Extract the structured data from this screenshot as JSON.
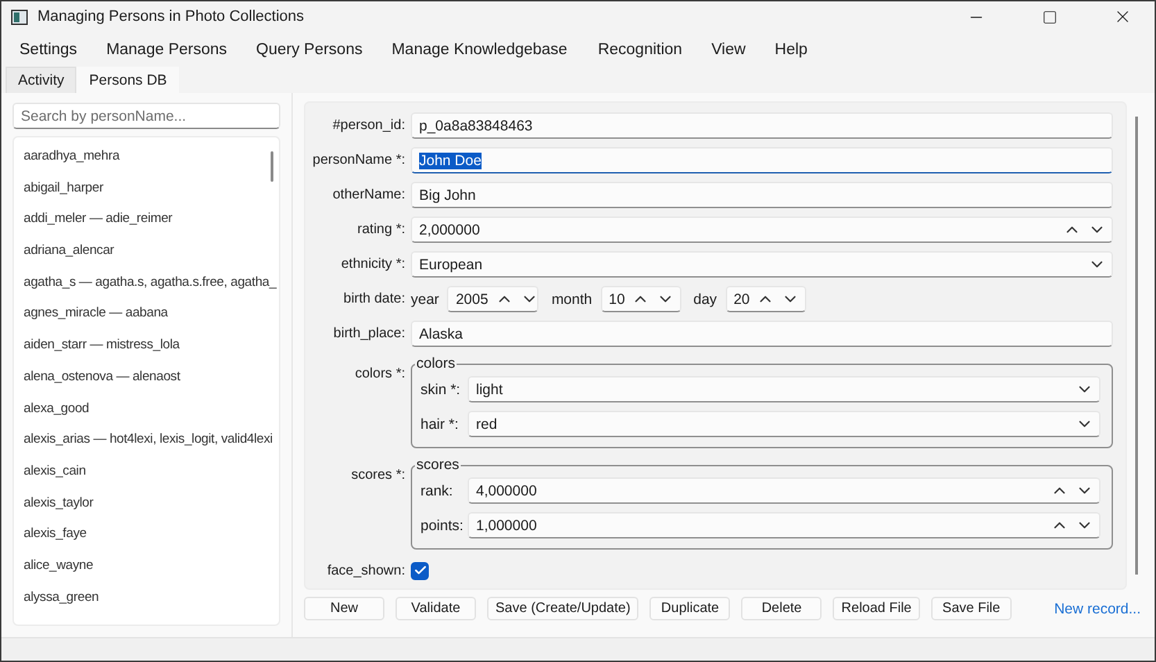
{
  "window": {
    "title": "Managing Persons in Photo Collections"
  },
  "menu": [
    "Settings",
    "Manage Persons",
    "Query Persons",
    "Manage Knowledgebase",
    "Recognition",
    "View",
    "Help"
  ],
  "tabs": [
    {
      "label": "Activity",
      "selected": false
    },
    {
      "label": "Persons DB",
      "selected": true
    }
  ],
  "sidebar": {
    "search": {
      "placeholder": "Search by personName..."
    },
    "items": [
      "aaradhya_mehra",
      "abigail_harper",
      "addi_meler — adie_reimer",
      "adriana_alencar",
      "agatha_s — agatha.s, agatha.s.free, agatha_",
      "agnes_miracle — aabana",
      "aiden_starr — mistress_lola",
      "alena_ostenova — alenaost",
      "alexa_good",
      "alexis_arias — hot4lexi, lexis_logit, valid4lexi",
      "alexis_cain",
      "alexis_taylor",
      "alexis_faye",
      "alice_wayne",
      "alyssa_green"
    ]
  },
  "form": {
    "fields": [
      {
        "kind": "text",
        "label": "#person_id:",
        "value": "p_0a8a83848463",
        "focused": false
      },
      {
        "kind": "text",
        "label": "personName *:",
        "value": "John Doe",
        "focused": true
      },
      {
        "kind": "text",
        "label": "otherName:",
        "value": "Big John",
        "focused": false
      },
      {
        "kind": "spin",
        "label": "rating *:",
        "value": "2,000000"
      },
      {
        "kind": "dropdown",
        "label": "ethnicity *:",
        "value": "European"
      },
      {
        "kind": "date",
        "label": "birth date:",
        "parts": [
          {
            "label": "year",
            "value": "2005"
          },
          {
            "label": "month",
            "value": "10"
          },
          {
            "label": "day",
            "value": "20"
          }
        ]
      },
      {
        "kind": "text",
        "label": "birth_place:",
        "value": "Alaska",
        "focused": false
      },
      {
        "kind": "group",
        "label": "colors *:",
        "legend": "colors",
        "fields": [
          {
            "kind": "dropdown",
            "label": "skin *:",
            "value": "light"
          },
          {
            "kind": "dropdown",
            "label": "hair *:",
            "value": "red"
          }
        ]
      },
      {
        "kind": "group",
        "label": "scores *:",
        "legend": "scores",
        "fields": [
          {
            "kind": "spin",
            "label": "rank:",
            "value": "4,000000"
          },
          {
            "kind": "spin",
            "label": "points:",
            "value": "1,000000"
          }
        ]
      },
      {
        "kind": "checkbox",
        "label": "face_shown:",
        "checked": true
      }
    ]
  },
  "buttons": [
    "New",
    "Validate",
    "Save (Create/Update)",
    "Duplicate",
    "Delete",
    "Reload File",
    "Save File"
  ],
  "link": "New record..."
}
